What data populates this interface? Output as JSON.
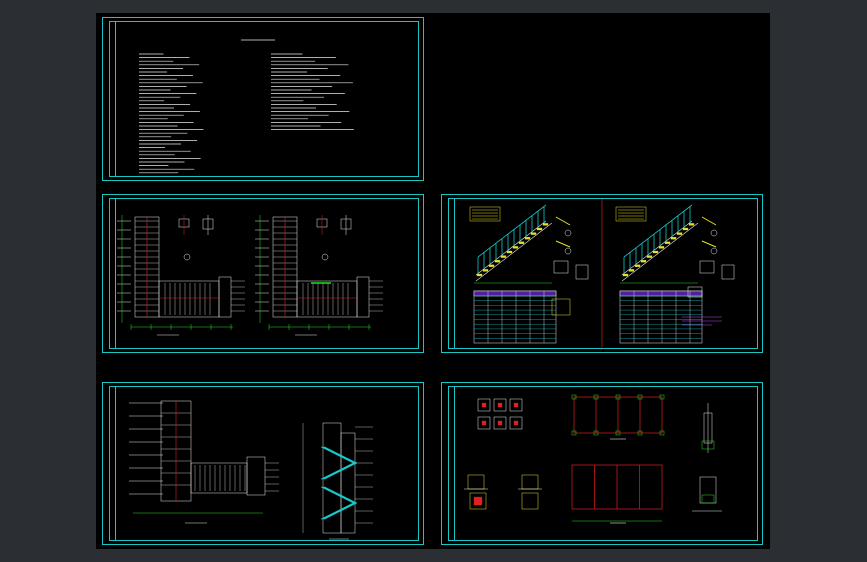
{
  "app": {
    "colors": {
      "background": "#2b2f33",
      "canvas": "#000000",
      "frame": "#19c6c6",
      "line_white": "#e8e8e8",
      "line_red": "#e02020",
      "line_green": "#20e020",
      "line_yellow": "#e8e020",
      "fill_cyan": "#17c8c8"
    }
  },
  "drawing_sheets": [
    {
      "name": "design-notes-sheet",
      "kind": "text-notes",
      "icon": "notes-icon"
    },
    {
      "name": "floor-plans-sheet",
      "kind": "stair-plans",
      "icon": "plan-icon"
    },
    {
      "name": "steel-stair-details-sheet",
      "kind": "stair-elevations-and-schedules",
      "icon": "detail-icon"
    },
    {
      "name": "stair-plan-and-section-sheet",
      "kind": "plan-and-section",
      "icon": "section-icon"
    },
    {
      "name": "foundation-plan-sheet",
      "kind": "foundation-and-column-details",
      "icon": "foundation-icon"
    }
  ]
}
